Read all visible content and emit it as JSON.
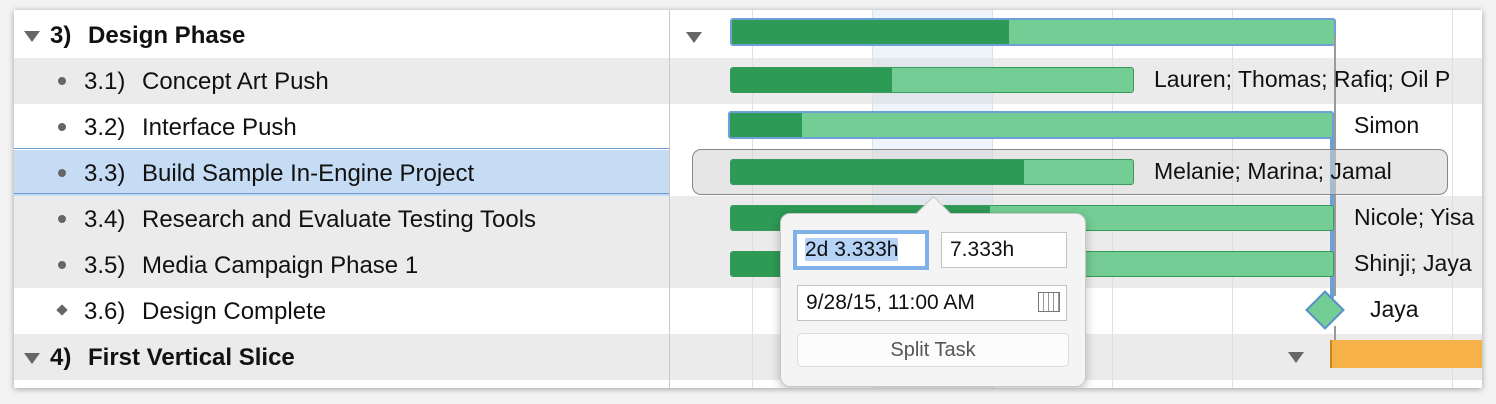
{
  "outline": {
    "rows": [
      {
        "num": "3)",
        "title": "Design Phase"
      },
      {
        "num": "3.1)",
        "title": "Concept Art Push"
      },
      {
        "num": "3.2)",
        "title": "Interface Push"
      },
      {
        "num": "3.3)",
        "title": "Build Sample In-Engine Project"
      },
      {
        "num": "3.4)",
        "title": "Research and Evaluate Testing Tools"
      },
      {
        "num": "3.5)",
        "title": "Media Campaign Phase 1"
      },
      {
        "num": "3.6)",
        "title": "Design Complete"
      },
      {
        "num": "4)",
        "title": "First Vertical Slice"
      }
    ]
  },
  "gantt": {
    "resources": [
      "Lauren; Thomas; Rafiq; Oil P",
      "Simon",
      "Melanie; Marina; Jamal",
      "Nicole; Yisa",
      "Shinji; Jaya",
      "Jaya"
    ],
    "progress": {
      "design_phase": 0.46,
      "concept_art": 0.4,
      "interface": 0.12,
      "build_sample": 0.73,
      "research": 0.43,
      "media": 0.1
    },
    "colors": {
      "complete": "#2d9a55",
      "remaining": "#74cd94",
      "vertical_slice": "#f6b149",
      "selection": "#c6dcf4"
    }
  },
  "popover": {
    "duration": "2d 3.333h",
    "effort": "7.333h",
    "start_date": "9/28/15, 11:00 AM",
    "split_label": "Split Task",
    "calendar_icon": "calendar-icon"
  }
}
